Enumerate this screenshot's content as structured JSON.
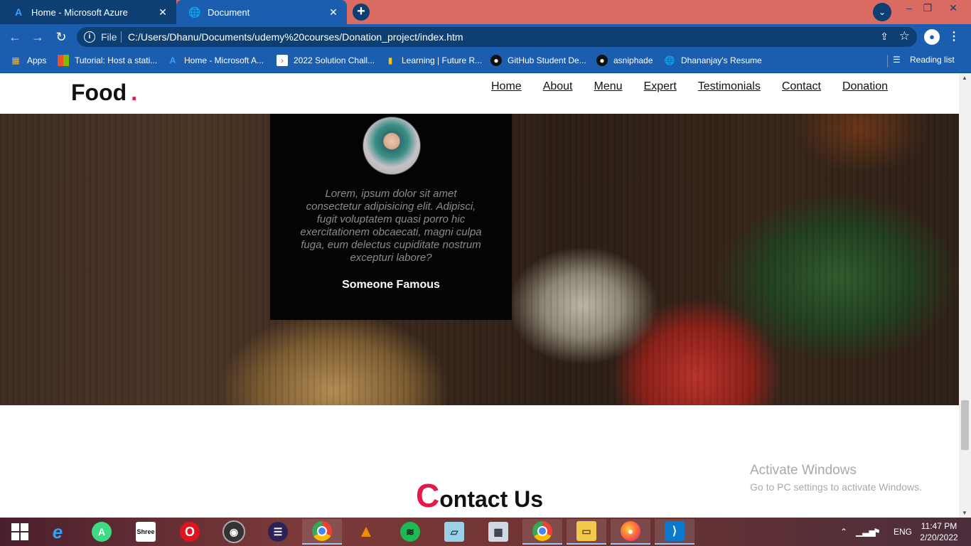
{
  "browser": {
    "tabs": [
      {
        "title": "Home - Microsoft Azure",
        "favicon": "azure-icon"
      },
      {
        "title": "Document",
        "favicon": "globe-icon"
      }
    ],
    "new_tab": "+",
    "address": {
      "scheme_label": "File",
      "url": "C:/Users/Dhanu/Documents/udemy%20courses/Donation_project/index.htm"
    },
    "bookmarks": [
      {
        "label": "Apps",
        "icon": "apps-grid-icon"
      },
      {
        "label": "Tutorial: Host a stati...",
        "icon": "microsoft-icon"
      },
      {
        "label": "Home - Microsoft A...",
        "icon": "azure-icon"
      },
      {
        "label": "2022 Solution Chall...",
        "icon": "gdsc-icon"
      },
      {
        "label": "Learning | Future R...",
        "icon": "learning-icon"
      },
      {
        "label": "GitHub Student De...",
        "icon": "github-icon"
      },
      {
        "label": "asniphade",
        "icon": "github-icon"
      },
      {
        "label": "Dhananjay's Resume",
        "icon": "globe-icon"
      }
    ],
    "reading_list": "Reading list"
  },
  "site": {
    "logo": "Food",
    "logo_dot": ".",
    "nav": [
      "Home",
      "About",
      "Menu",
      "Expert",
      "Testimonials",
      "Contact",
      "Donation"
    ],
    "testimonial": {
      "quote": "Lorem, ipsum dolor sit amet consectetur adipisicing elit. Adipisci, fugit voluptatem quasi porro hic exercitationem obcaecati, magni culpa fuga, eum delectus cupiditate nostrum excepturi labore?",
      "author": "Someone Famous"
    },
    "contact_heading_first": "C",
    "contact_heading_rest": "ontact Us"
  },
  "overlay": {
    "activate_title": "Activate Windows",
    "activate_sub": "Go to PC settings to activate Windows."
  },
  "taskbar": {
    "language": "ENG",
    "time": "11:47 PM",
    "date": "2/20/2022"
  },
  "colors": {
    "accent": "#e8174a",
    "chrome_tab_strip": "#d96b63",
    "chrome_toolbar": "#1b5eb0"
  }
}
